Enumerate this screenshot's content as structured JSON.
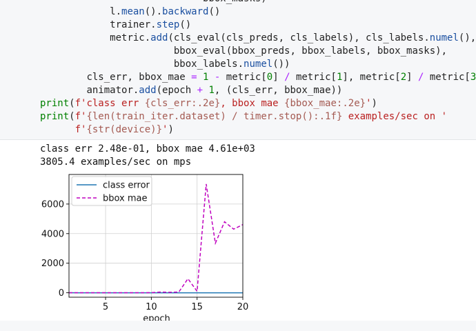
{
  "code_lines": [
    {
      "indent": "                            ",
      "segments": [
        {
          "c": "",
          "t": "bbox_masks)"
        }
      ]
    },
    {
      "indent": "            ",
      "segments": [
        {
          "c": "",
          "t": "l."
        },
        {
          "c": "nm",
          "t": "mean"
        },
        {
          "c": "",
          "t": "()."
        },
        {
          "c": "nm",
          "t": "backward"
        },
        {
          "c": "",
          "t": "()"
        }
      ]
    },
    {
      "indent": "            ",
      "segments": [
        {
          "c": "",
          "t": "trainer."
        },
        {
          "c": "nm",
          "t": "step"
        },
        {
          "c": "",
          "t": "()"
        }
      ]
    },
    {
      "indent": "            ",
      "segments": [
        {
          "c": "",
          "t": "metric."
        },
        {
          "c": "nm",
          "t": "add"
        },
        {
          "c": "",
          "t": "(cls_eval(cls_preds, cls_labels), cls_labels."
        },
        {
          "c": "nm",
          "t": "numel"
        },
        {
          "c": "",
          "t": "(),"
        }
      ]
    },
    {
      "indent": "                       ",
      "segments": [
        {
          "c": "",
          "t": "bbox_eval(bbox_preds, bbox_labels, bbox_masks),"
        }
      ]
    },
    {
      "indent": "                       ",
      "segments": [
        {
          "c": "",
          "t": "bbox_labels."
        },
        {
          "c": "nm",
          "t": "numel"
        },
        {
          "c": "",
          "t": "())"
        }
      ]
    },
    {
      "indent": "        ",
      "segments": [
        {
          "c": "",
          "t": "cls_err, bbox_mae "
        },
        {
          "c": "op",
          "t": "="
        },
        {
          "c": "",
          "t": " "
        },
        {
          "c": "num",
          "t": "1"
        },
        {
          "c": "",
          "t": " "
        },
        {
          "c": "op",
          "t": "-"
        },
        {
          "c": "",
          "t": " metric["
        },
        {
          "c": "num",
          "t": "0"
        },
        {
          "c": "",
          "t": "] "
        },
        {
          "c": "op",
          "t": "/"
        },
        {
          "c": "",
          "t": " metric["
        },
        {
          "c": "num",
          "t": "1"
        },
        {
          "c": "",
          "t": "], metric["
        },
        {
          "c": "num",
          "t": "2"
        },
        {
          "c": "",
          "t": "] "
        },
        {
          "c": "op",
          "t": "/"
        },
        {
          "c": "",
          "t": " metric["
        },
        {
          "c": "num",
          "t": "3"
        },
        {
          "c": "",
          "t": "]"
        }
      ]
    },
    {
      "indent": "        ",
      "segments": [
        {
          "c": "",
          "t": "animator."
        },
        {
          "c": "nm",
          "t": "add"
        },
        {
          "c": "",
          "t": "(epoch "
        },
        {
          "c": "op",
          "t": "+"
        },
        {
          "c": "",
          "t": " "
        },
        {
          "c": "num",
          "t": "1"
        },
        {
          "c": "",
          "t": ", (cls_err, bbox_mae))"
        }
      ]
    },
    {
      "indent": "",
      "segments": [
        {
          "c": "kw",
          "t": "print"
        },
        {
          "c": "",
          "t": "("
        },
        {
          "c": "str",
          "t": "f'class err "
        },
        {
          "c": "fmt",
          "t": "{cls_err:.2e}"
        },
        {
          "c": "str",
          "t": ", bbox mae "
        },
        {
          "c": "fmt",
          "t": "{bbox_mae:.2e}"
        },
        {
          "c": "str",
          "t": "'"
        },
        {
          "c": "",
          "t": ")"
        }
      ]
    },
    {
      "indent": "",
      "segments": [
        {
          "c": "kw",
          "t": "print"
        },
        {
          "c": "",
          "t": "("
        },
        {
          "c": "str",
          "t": "f'"
        },
        {
          "c": "fmt",
          "t": "{len(train_iter.dataset) / timer.stop():.1f}"
        },
        {
          "c": "str",
          "t": " examples/sec on '"
        }
      ]
    },
    {
      "indent": "      ",
      "segments": [
        {
          "c": "str",
          "t": "f'"
        },
        {
          "c": "fmt",
          "t": "{str(device)}"
        },
        {
          "c": "str",
          "t": "'"
        },
        {
          "c": "",
          "t": ")"
        }
      ]
    }
  ],
  "output": {
    "line1": "class err 2.48e-01, bbox mae 4.61e+03",
    "line2": "3805.4 examples/sec on mps"
  },
  "chart_data": {
    "type": "line",
    "title": "",
    "xlabel": "epoch",
    "ylabel": "",
    "xlim": [
      1,
      20
    ],
    "ylim": [
      -300,
      8000
    ],
    "xticks": [
      5,
      10,
      15,
      20
    ],
    "yticks": [
      0,
      2000,
      4000,
      6000
    ],
    "grid": true,
    "legend_position": "top-left",
    "series": [
      {
        "name": "class error",
        "color": "#1f77b4",
        "dash": "solid",
        "x": [
          1,
          2,
          3,
          4,
          5,
          6,
          7,
          8,
          9,
          10,
          11,
          12,
          13,
          14,
          15,
          16,
          17,
          18,
          19,
          20
        ],
        "y": [
          0.9,
          0.5,
          0.4,
          0.35,
          0.33,
          0.32,
          0.31,
          0.3,
          0.3,
          0.29,
          0.29,
          0.28,
          0.28,
          0.27,
          0.27,
          0.26,
          0.26,
          0.25,
          0.25,
          0.25
        ]
      },
      {
        "name": "bbox mae",
        "color": "#bf00bf",
        "dash": "dashed",
        "x": [
          1,
          2,
          3,
          4,
          5,
          6,
          7,
          8,
          9,
          10,
          11,
          12,
          13,
          14,
          15,
          16,
          17,
          18,
          19,
          20
        ],
        "y": [
          5,
          5,
          5,
          5,
          5,
          5,
          5,
          5,
          5,
          10,
          50,
          30,
          50,
          950,
          100,
          7350,
          3350,
          4800,
          4300,
          4610
        ]
      }
    ]
  }
}
